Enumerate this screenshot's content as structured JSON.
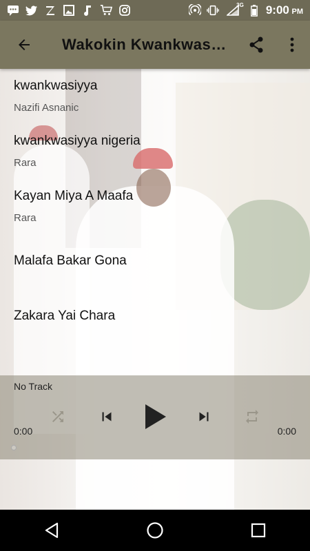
{
  "status_bar": {
    "time": "9:00",
    "time_suffix": "PM",
    "network": "3G",
    "left_icons": [
      "messages-icon",
      "twitter-icon",
      "z-app-icon",
      "image-icon",
      "music-note-icon",
      "cart-icon",
      "instagram-icon"
    ],
    "right_icons": [
      "hotspot-icon",
      "vibrate-icon",
      "signal-icon",
      "battery-icon"
    ]
  },
  "toolbar": {
    "title": "Wakokin  Kwankwasiyya",
    "back_icon": "arrow-left-icon",
    "share_icon": "share-icon",
    "menu_icon": "more-vert-icon"
  },
  "tracks": [
    {
      "title": "kwankwasiyya",
      "artist": "Nazifi Asnanic"
    },
    {
      "title": "kwankwasiyya nigeria",
      "artist": "Rara"
    },
    {
      "title": "Kayan Miya A Maafa",
      "artist": "Rara"
    },
    {
      "title": "Malafa Bakar Gona",
      "artist": ""
    },
    {
      "title": "Zakara Yai Chara",
      "artist": ""
    }
  ],
  "player": {
    "now_playing": "No Track",
    "current_time": "0:00",
    "duration": "0:00",
    "progress": 0,
    "controls": [
      "shuffle-icon",
      "skip-previous-icon",
      "play-icon",
      "skip-next-icon",
      "repeat-icon"
    ]
  },
  "colors": {
    "toolbar": "#7b775f",
    "status_bar": "#6e6a56",
    "player_bg": "#8c8676"
  }
}
